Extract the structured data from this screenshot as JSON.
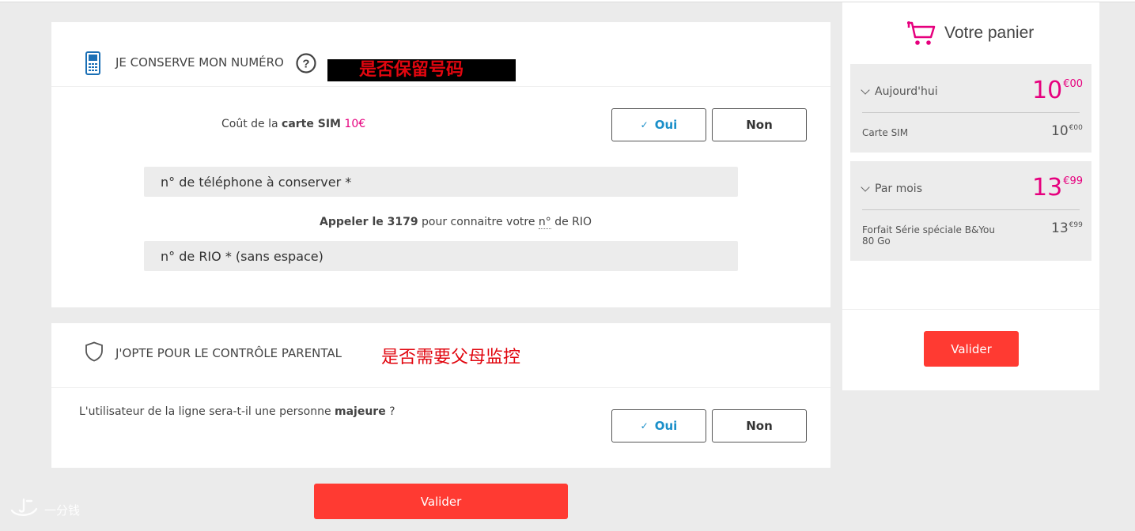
{
  "annotations": {
    "keep_number_cn": "是否保留号码",
    "parental_cn": "是否需要父母监控"
  },
  "keep_number": {
    "title": "JE CONSERVE MON NUMÉRO",
    "help_icon": "question-circle-icon",
    "sim_cost_prefix": "Coût de la ",
    "sim_cost_bold": "carte SIM",
    "sim_cost_value": " 10€",
    "oui": "Oui",
    "non": "Non",
    "phone_placeholder": "n° de téléphone à conserver *",
    "rio_hint_bold": "Appeler le 3179",
    "rio_hint_mid": " pour connaitre votre ",
    "rio_hint_abbr": "n°",
    "rio_hint_end": " de RIO",
    "rio_placeholder": "n° de RIO * (sans espace)"
  },
  "parental": {
    "title": "J'OPTE POUR LE CONTRÔLE PARENTAL",
    "question_prefix": "L'utilisateur de la ligne sera-t-il une personne ",
    "question_bold": "majeure",
    "question_suffix": " ?",
    "oui": "Oui",
    "non": "Non"
  },
  "main_submit": "Valider",
  "cart": {
    "title": "Votre panier",
    "today": {
      "label": "Aujourd'hui",
      "total_int": "10",
      "total_dec": "€00",
      "item_label": "Carte SIM",
      "item_int": "10",
      "item_dec": "€00"
    },
    "monthly": {
      "label": "Par mois",
      "total_int": "13",
      "total_dec": "€99",
      "item_label": "Forfait Série spéciale B&You 80 Go",
      "item_int": "13",
      "item_dec": "€99"
    },
    "submit": "Valider"
  },
  "watermark": "一分钱",
  "colors": {
    "accent_pink": "#e6007e",
    "button_red": "#ff3a32",
    "oui_blue": "#1a8fc9"
  }
}
